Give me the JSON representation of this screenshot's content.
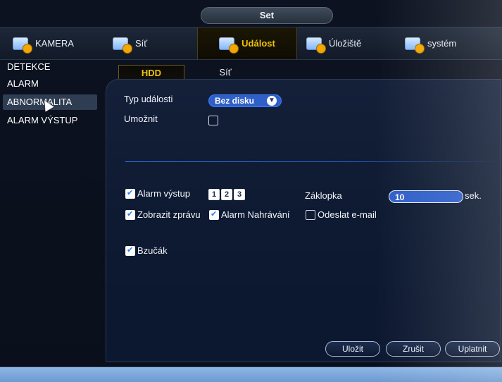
{
  "window": {
    "title": "Set"
  },
  "topnav": {
    "tabs": [
      {
        "label": "KAMERA",
        "icon": "camera-icon"
      },
      {
        "label": "Síť",
        "icon": "network-icon"
      },
      {
        "label": "Událost",
        "icon": "event-icon",
        "active": true
      },
      {
        "label": "Úložiště",
        "icon": "storage-icon"
      },
      {
        "label": "systém",
        "icon": "system-icon"
      }
    ]
  },
  "sidebar": {
    "items": [
      {
        "label": "DETEKCE"
      },
      {
        "label": "ALARM"
      },
      {
        "label": "ABNORMALITA",
        "selected": true
      },
      {
        "label": "ALARM VÝSTUP"
      }
    ]
  },
  "subtabs": [
    {
      "label": "HDD",
      "active": true
    },
    {
      "label": "Síť"
    }
  ],
  "form": {
    "event_type_label": "Typ události",
    "event_type_value": "Bez disku",
    "enable_label": "Umožnit",
    "alarm_out_label": "Alarm výstup",
    "alarm_out_channels": [
      "1",
      "2",
      "3"
    ],
    "latch_label": "Záklopka",
    "latch_value": "10",
    "latch_unit": "sek.",
    "show_message_label": "Zobrazit zprávu",
    "alarm_record_label": "Alarm Nahrávání",
    "send_email_label": "Odeslat e-mail",
    "buzzer_label": "Bzučák"
  },
  "buttons": {
    "save": "Uložit",
    "cancel": "Zrušit",
    "apply": "Uplatnit"
  },
  "colors": {
    "accent_yellow": "#f0c400",
    "select_blue": "#2f5fc9",
    "divider_blue": "#3b7bff"
  }
}
